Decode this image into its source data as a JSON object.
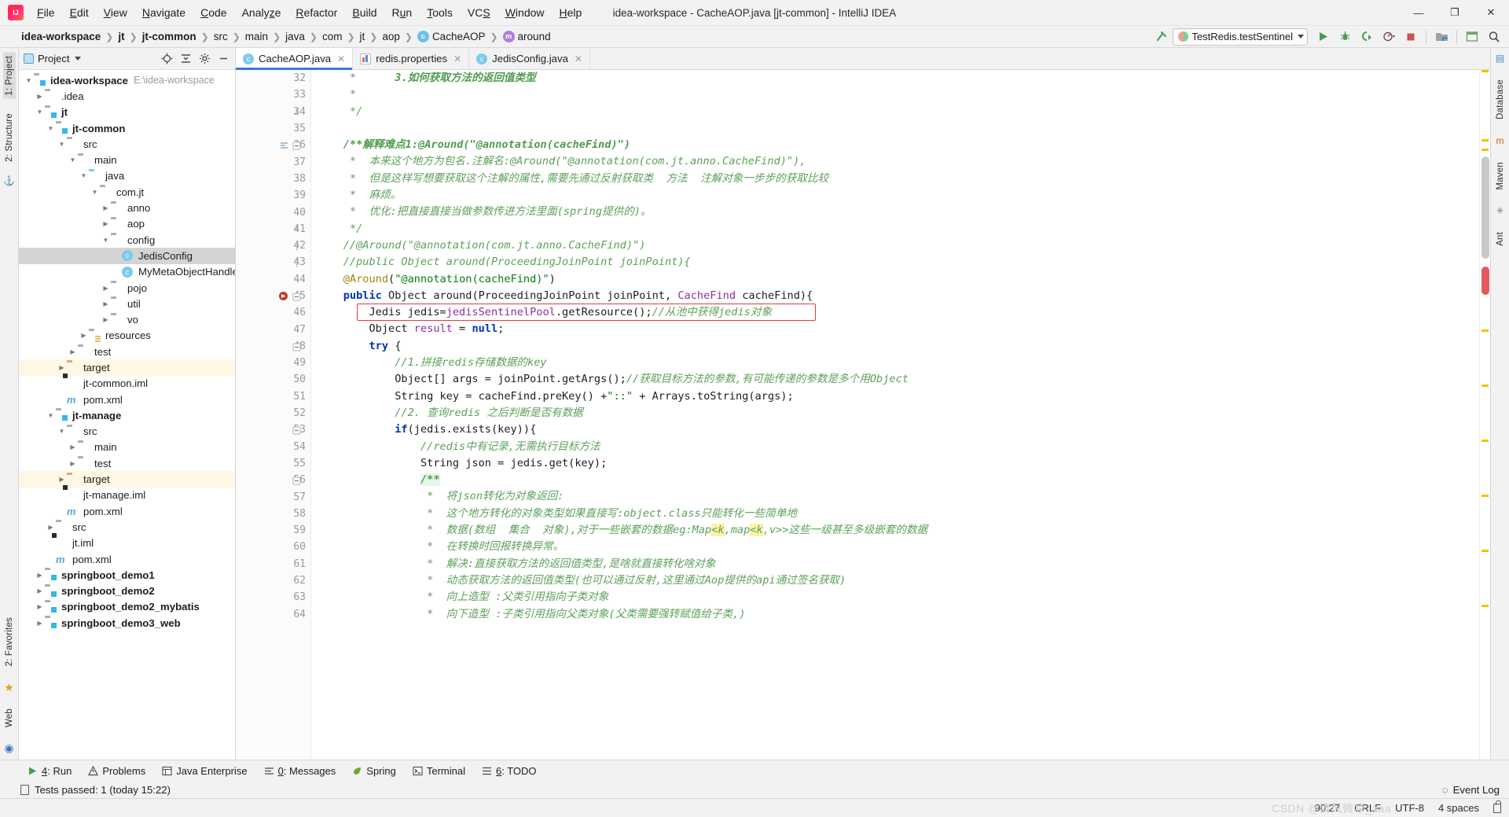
{
  "titlebar": {
    "window_title": "idea-workspace - CacheAOP.java [jt-common] - IntelliJ IDEA",
    "logo": "intellij-idea-logo",
    "menus": [
      "File",
      "Edit",
      "View",
      "Navigate",
      "Code",
      "Analyze",
      "Refactor",
      "Build",
      "Run",
      "Tools",
      "VCS",
      "Window",
      "Help"
    ],
    "minimize": "—",
    "maximize": "❐",
    "close": "✕"
  },
  "navbar": {
    "crumbs": [
      {
        "label": "idea-workspace",
        "bold": true,
        "badge": ""
      },
      {
        "label": "jt",
        "bold": true,
        "badge": ""
      },
      {
        "label": "jt-common",
        "bold": true,
        "badge": ""
      },
      {
        "label": "src",
        "bold": false,
        "badge": ""
      },
      {
        "label": "main",
        "bold": false,
        "badge": ""
      },
      {
        "label": "java",
        "bold": false,
        "badge": ""
      },
      {
        "label": "com",
        "bold": false,
        "badge": ""
      },
      {
        "label": "jt",
        "bold": false,
        "badge": ""
      },
      {
        "label": "aop",
        "bold": false,
        "badge": ""
      },
      {
        "label": "CacheAOP",
        "bold": false,
        "badge": "c"
      },
      {
        "label": "around",
        "bold": false,
        "badge": "m"
      }
    ],
    "separator": "❯",
    "run_config": "TestRedis.testSentinel",
    "icons": [
      "hammer-icon",
      "run-icon",
      "debug-icon",
      "run-coverage-icon",
      "profile-icon",
      "stop-icon",
      "project-structure-icon",
      "layout-icon",
      "search-everywhere-icon"
    ]
  },
  "left_rail": {
    "top": [
      "1: Project",
      "2: Structure"
    ],
    "bottom": [
      "2: Favorites",
      "Web"
    ]
  },
  "right_rail": [
    "Database",
    "Maven",
    "Ant"
  ],
  "project_panel": {
    "title": "Project",
    "header_icons": [
      "locate-icon",
      "collapse-all-icon",
      "settings-icon",
      "hide-icon"
    ],
    "tree": [
      {
        "depth": 0,
        "arrow": "down",
        "icon": "module-folder",
        "label": "idea-workspace",
        "bold": true,
        "path": "E:\\idea-workspace",
        "state": "normal"
      },
      {
        "depth": 1,
        "arrow": "right",
        "icon": "folder",
        "label": ".idea",
        "bold": false,
        "path": "",
        "state": "normal"
      },
      {
        "depth": 1,
        "arrow": "down",
        "icon": "module-folder",
        "label": "jt",
        "bold": true,
        "path": "",
        "state": "normal"
      },
      {
        "depth": 2,
        "arrow": "down",
        "icon": "module-folder",
        "label": "jt-common",
        "bold": true,
        "path": "",
        "state": "normal"
      },
      {
        "depth": 3,
        "arrow": "down",
        "icon": "folder",
        "label": "src",
        "bold": false,
        "path": "",
        "state": "normal"
      },
      {
        "depth": 4,
        "arrow": "down",
        "icon": "folder",
        "label": "main",
        "bold": false,
        "path": "",
        "state": "normal"
      },
      {
        "depth": 5,
        "arrow": "down",
        "icon": "folder-blue",
        "label": "java",
        "bold": false,
        "path": "",
        "state": "normal"
      },
      {
        "depth": 6,
        "arrow": "down",
        "icon": "package",
        "label": "com.jt",
        "bold": false,
        "path": "",
        "state": "normal"
      },
      {
        "depth": 7,
        "arrow": "right",
        "icon": "package",
        "label": "anno",
        "bold": false,
        "path": "",
        "state": "normal"
      },
      {
        "depth": 7,
        "arrow": "right",
        "icon": "package",
        "label": "aop",
        "bold": false,
        "path": "",
        "state": "normal"
      },
      {
        "depth": 7,
        "arrow": "down",
        "icon": "package",
        "label": "config",
        "bold": false,
        "path": "",
        "state": "normal"
      },
      {
        "depth": 8,
        "arrow": "none",
        "icon": "class",
        "label": "JedisConfig",
        "bold": false,
        "path": "",
        "state": "selected"
      },
      {
        "depth": 8,
        "arrow": "none",
        "icon": "class",
        "label": "MyMetaObjectHandler",
        "bold": false,
        "path": "",
        "state": "normal"
      },
      {
        "depth": 7,
        "arrow": "right",
        "icon": "package",
        "label": "pojo",
        "bold": false,
        "path": "",
        "state": "normal"
      },
      {
        "depth": 7,
        "arrow": "right",
        "icon": "package",
        "label": "util",
        "bold": false,
        "path": "",
        "state": "normal"
      },
      {
        "depth": 7,
        "arrow": "right",
        "icon": "package",
        "label": "vo",
        "bold": false,
        "path": "",
        "state": "normal"
      },
      {
        "depth": 5,
        "arrow": "right",
        "icon": "resources",
        "label": "resources",
        "bold": false,
        "path": "",
        "state": "normal"
      },
      {
        "depth": 4,
        "arrow": "right",
        "icon": "folder",
        "label": "test",
        "bold": false,
        "path": "",
        "state": "normal"
      },
      {
        "depth": 3,
        "arrow": "right",
        "icon": "folder-orange",
        "label": "target",
        "bold": false,
        "path": "",
        "state": "highlight"
      },
      {
        "depth": 3,
        "arrow": "none",
        "icon": "iml",
        "label": "jt-common.iml",
        "bold": false,
        "path": "",
        "state": "normal"
      },
      {
        "depth": 3,
        "arrow": "none",
        "icon": "maven",
        "label": "pom.xml",
        "bold": false,
        "path": "",
        "state": "normal"
      },
      {
        "depth": 2,
        "arrow": "down",
        "icon": "module-folder",
        "label": "jt-manage",
        "bold": true,
        "path": "",
        "state": "normal"
      },
      {
        "depth": 3,
        "arrow": "down",
        "icon": "folder",
        "label": "src",
        "bold": false,
        "path": "",
        "state": "normal"
      },
      {
        "depth": 4,
        "arrow": "right",
        "icon": "folder",
        "label": "main",
        "bold": false,
        "path": "",
        "state": "normal"
      },
      {
        "depth": 4,
        "arrow": "right",
        "icon": "folder",
        "label": "test",
        "bold": false,
        "path": "",
        "state": "normal"
      },
      {
        "depth": 3,
        "arrow": "right",
        "icon": "folder-orange",
        "label": "target",
        "bold": false,
        "path": "",
        "state": "highlight"
      },
      {
        "depth": 3,
        "arrow": "none",
        "icon": "iml",
        "label": "jt-manage.iml",
        "bold": false,
        "path": "",
        "state": "normal"
      },
      {
        "depth": 3,
        "arrow": "none",
        "icon": "maven",
        "label": "pom.xml",
        "bold": false,
        "path": "",
        "state": "normal"
      },
      {
        "depth": 2,
        "arrow": "right",
        "icon": "folder",
        "label": "src",
        "bold": false,
        "path": "",
        "state": "normal"
      },
      {
        "depth": 2,
        "arrow": "none",
        "icon": "iml",
        "label": "jt.iml",
        "bold": false,
        "path": "",
        "state": "normal"
      },
      {
        "depth": 2,
        "arrow": "none",
        "icon": "maven",
        "label": "pom.xml",
        "bold": false,
        "path": "",
        "state": "normal"
      },
      {
        "depth": 1,
        "arrow": "right",
        "icon": "module-folder",
        "label": "springboot_demo1",
        "bold": true,
        "path": "",
        "state": "normal"
      },
      {
        "depth": 1,
        "arrow": "right",
        "icon": "module-folder",
        "label": "springboot_demo2",
        "bold": true,
        "path": "",
        "state": "normal"
      },
      {
        "depth": 1,
        "arrow": "right",
        "icon": "module-folder",
        "label": "springboot_demo2_mybatis",
        "bold": true,
        "path": "",
        "state": "normal"
      },
      {
        "depth": 1,
        "arrow": "right",
        "icon": "module-folder",
        "label": "springboot_demo3_web",
        "bold": true,
        "path": "",
        "state": "normal"
      }
    ]
  },
  "editor": {
    "tabs": [
      {
        "label": "CacheAOP.java",
        "icon": "java-class-icon",
        "active": true
      },
      {
        "label": "redis.properties",
        "icon": "properties-file-icon",
        "active": false
      },
      {
        "label": "JedisConfig.java",
        "icon": "java-class-icon",
        "active": false
      }
    ],
    "first_line_number": 32,
    "lines": [
      {
        "n": 32,
        "fold": "",
        "segs": [
          {
            "t": "     *      ",
            "c": "cmt"
          },
          {
            "t": "3.如何获取方法的返回值类型",
            "c": "cmtb"
          }
        ]
      },
      {
        "n": 33,
        "fold": "",
        "segs": [
          {
            "t": "     *",
            "c": "cmt"
          }
        ]
      },
      {
        "n": 34,
        "fold": "end",
        "segs": [
          {
            "t": "     */",
            "c": "cmt"
          }
        ]
      },
      {
        "n": 35,
        "fold": "",
        "segs": [
          {
            "t": "",
            "c": "cmt"
          }
        ]
      },
      {
        "n": 36,
        "fold": "start",
        "segs": [
          {
            "t": "    /**解释难点1:@Around(\"@annotation(cacheFind)\")",
            "c": "cmtb"
          }
        ]
      },
      {
        "n": 37,
        "fold": "",
        "segs": [
          {
            "t": "     *  本来这个地方为包名.注解名:@Around(\"@annotation(com.jt.anno.CacheFind)\"),",
            "c": "cmt"
          }
        ]
      },
      {
        "n": 38,
        "fold": "",
        "segs": [
          {
            "t": "     *  但是这样写想要获取这个注解的属性,需要先通过反射获取类  方法  注解对象一步步的获取比较",
            "c": "cmt"
          }
        ]
      },
      {
        "n": 39,
        "fold": "",
        "segs": [
          {
            "t": "     *  麻烦。",
            "c": "cmt"
          }
        ]
      },
      {
        "n": 40,
        "fold": "",
        "segs": [
          {
            "t": "     *  优化:把直接直接当做参数传进方法里面(spring提供的)。",
            "c": "cmt"
          }
        ]
      },
      {
        "n": 41,
        "fold": "end",
        "segs": [
          {
            "t": "     */",
            "c": "cmt"
          }
        ]
      },
      {
        "n": 42,
        "fold": "mid",
        "segs": [
          {
            "t": "    //@Around(\"@annotation(com.jt.anno.CacheFind)\")",
            "c": "cmt"
          }
        ]
      },
      {
        "n": 43,
        "fold": "mid",
        "segs": [
          {
            "t": "    //public Object around(ProceedingJoinPoint joinPoint){",
            "c": "cmt"
          }
        ]
      },
      {
        "n": 44,
        "fold": "",
        "segs": [
          {
            "t": "    ",
            "c": "typ"
          },
          {
            "t": "@Around",
            "c": "ann"
          },
          {
            "t": "(",
            "c": "typ"
          },
          {
            "t": "\"@annotation(cacheFind)\"",
            "c": "str"
          },
          {
            "t": ")",
            "c": "typ"
          }
        ]
      },
      {
        "n": 45,
        "fold": "start",
        "segs": [
          {
            "t": "    ",
            "c": "typ"
          },
          {
            "t": "public ",
            "c": "kw"
          },
          {
            "t": "Object ",
            "c": "typ"
          },
          {
            "t": "around",
            "c": "typ"
          },
          {
            "t": "(ProceedingJoinPoint joinPoint, ",
            "c": "typ"
          },
          {
            "t": "CacheFind",
            "c": "fld"
          },
          {
            "t": " cacheFind){",
            "c": "typ"
          }
        ]
      },
      {
        "n": 46,
        "fold": "",
        "segs": [
          {
            "t": "        Jedis jedis=",
            "c": "typ"
          },
          {
            "t": "jedisSentinelPool",
            "c": "fld"
          },
          {
            "t": ".getResource();",
            "c": "typ"
          },
          {
            "t": "//从池中获得jedis对象",
            "c": "cmt"
          }
        ]
      },
      {
        "n": 47,
        "fold": "",
        "segs": [
          {
            "t": "        Object ",
            "c": "typ"
          },
          {
            "t": "result",
            "c": "fld"
          },
          {
            "t": " = ",
            "c": "typ"
          },
          {
            "t": "null",
            "c": "kw"
          },
          {
            "t": ";",
            "c": "typ"
          }
        ]
      },
      {
        "n": 48,
        "fold": "start",
        "segs": [
          {
            "t": "        ",
            "c": "typ"
          },
          {
            "t": "try",
            "c": "kw"
          },
          {
            "t": " {",
            "c": "typ"
          }
        ]
      },
      {
        "n": 49,
        "fold": "",
        "segs": [
          {
            "t": "            //1.拼接redis存储数据的key",
            "c": "cmt"
          }
        ]
      },
      {
        "n": 50,
        "fold": "",
        "segs": [
          {
            "t": "            Object[] args = joinPoint.getArgs();",
            "c": "typ"
          },
          {
            "t": "//获取目标方法的参数,有可能传递的参数是多个用Object",
            "c": "cmt"
          }
        ]
      },
      {
        "n": 51,
        "fold": "",
        "segs": [
          {
            "t": "            String key = cacheFind.preKey() +",
            "c": "typ"
          },
          {
            "t": "\"::\"",
            "c": "str"
          },
          {
            "t": " + Arrays.",
            "c": "typ"
          },
          {
            "t": "toString",
            "c": "typ"
          },
          {
            "t": "(args);",
            "c": "typ"
          }
        ]
      },
      {
        "n": 52,
        "fold": "",
        "segs": [
          {
            "t": "            //2. 查询redis 之后判断是否有数据",
            "c": "cmt"
          }
        ]
      },
      {
        "n": 53,
        "fold": "start",
        "segs": [
          {
            "t": "            ",
            "c": "typ"
          },
          {
            "t": "if",
            "c": "kw"
          },
          {
            "t": "(jedis.exists(key)){",
            "c": "typ"
          }
        ]
      },
      {
        "n": 54,
        "fold": "",
        "segs": [
          {
            "t": "                //redis中有记录,无需执行目标方法",
            "c": "cmt"
          }
        ]
      },
      {
        "n": 55,
        "fold": "",
        "segs": [
          {
            "t": "                String json = jedis.get(key);",
            "c": "typ"
          }
        ]
      },
      {
        "n": 56,
        "fold": "start",
        "segs": [
          {
            "t": "                ",
            "c": "typ"
          },
          {
            "t": "/**",
            "c": "cmtb-hl"
          }
        ]
      },
      {
        "n": 57,
        "fold": "",
        "segs": [
          {
            "t": "                 *  将json转化为对象返回:",
            "c": "cmt"
          }
        ]
      },
      {
        "n": 58,
        "fold": "",
        "segs": [
          {
            "t": "                 *  这个地方转化的对象类型如果直接写:object.class只能转化一些简单地",
            "c": "cmt"
          }
        ]
      },
      {
        "n": 59,
        "fold": "",
        "segs": [
          {
            "t": "                 *  数据(数组  集合  对象),对于一些嵌套的数据eg:Map<k,map<k,v>>这些一级甚至多级嵌套的数据",
            "c": "cmt"
          }
        ]
      },
      {
        "n": 60,
        "fold": "",
        "segs": [
          {
            "t": "                 *  在转换时回报转换异常。",
            "c": "cmt"
          }
        ]
      },
      {
        "n": 61,
        "fold": "",
        "segs": [
          {
            "t": "                 *  解决:直接获取方法的返回值类型,是啥就直接转化啥对象",
            "c": "cmt"
          }
        ]
      },
      {
        "n": 62,
        "fold": "",
        "segs": [
          {
            "t": "                 *  动态获取方法的返回值类型(也可以通过反射,这里通过Aop提供的api通过签名获取)",
            "c": "cmt"
          }
        ]
      },
      {
        "n": 63,
        "fold": "",
        "segs": [
          {
            "t": "                 *  向上造型 :父类引用指向子类对象",
            "c": "cmt"
          }
        ]
      },
      {
        "n": 64,
        "fold": "",
        "segs": [
          {
            "t": "                 *  向下造型 :子类引用指向父类对象(父类需要强转赋值给子类,)",
            "c": "cmt"
          }
        ]
      }
    ],
    "red_box_line": 46,
    "breakpoint_line": 45
  },
  "bottom_tabs": [
    {
      "label": "4: Run",
      "underline": "4",
      "icon": "run-icon"
    },
    {
      "label": "Problems",
      "underline": "",
      "icon": "warning-icon"
    },
    {
      "label": "Java Enterprise",
      "underline": "",
      "icon": "java-ee-icon"
    },
    {
      "label": "0: Messages",
      "underline": "0",
      "icon": "messages-icon"
    },
    {
      "label": "Spring",
      "underline": "",
      "icon": "spring-leaf-icon"
    },
    {
      "label": "Terminal",
      "underline": "",
      "icon": "terminal-icon"
    },
    {
      "label": "6: TODO",
      "underline": "6",
      "icon": "todo-icon"
    }
  ],
  "event_log": "Event Log",
  "tests_status": "Tests passed: 1 (today 15:22)",
  "statusbar": {
    "caret": "90:27",
    "line_separator": "CRLF",
    "encoding": "UTF-8",
    "indent": "4 spaces",
    "watermark": "CSDN @清风微凉_aaa"
  },
  "colors": {
    "accent": "#3a7dca",
    "comment": "#5ca158",
    "keyword": "#0033b3",
    "string": "#0a7c0a",
    "annotation": "#9e880d",
    "field": "#8c2fa0",
    "red_box": "#e23b3b",
    "highlight_row": "#fdf8e3",
    "selection": "#d4d4d4"
  }
}
